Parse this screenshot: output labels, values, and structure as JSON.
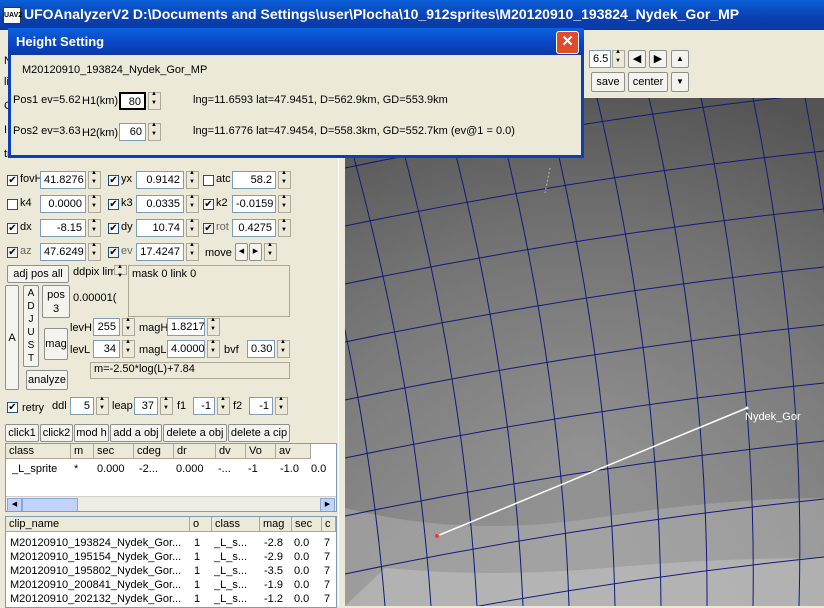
{
  "window": {
    "icon_text": "UAV2",
    "title": "UFOAnalyzerV2 D:\\Documents and Settings\\user\\Plocha\\10_912sprites\\M20120910_193824_Nydek_Gor_MP"
  },
  "top_controls": {
    "zoom_value": "6.5",
    "save_label": "save",
    "center_label": "center"
  },
  "dialog": {
    "title": "Height Setting",
    "clip_name": "M20120910_193824_Nydek_Gor_MP",
    "pos1_label": "Pos1 ev=5.62",
    "h1_label": "H1(km)",
    "h1_value": "80",
    "pos1_info": "lng=11.6593 lat=47.9451, D=562.9km, GD=553.9km",
    "pos2_label": "Pos2 ev=3.63",
    "h2_label": "H2(km)",
    "h2_value": "60",
    "pos2_info": "lng=11.6776 lat=47.9454, D=558.3km, GD=552.7km  (ev@1 = 0.0)"
  },
  "params": {
    "fovh_label": "fovH",
    "fovh_value": "41.8276",
    "yx_label": "yx",
    "yx_value": "0.9142",
    "atc_label": "atc",
    "atc_value": "58.2",
    "k4_label": "k4",
    "k4_value": "0.0000",
    "k3_label": "k3",
    "k3_value": "0.0335",
    "k2_label": "k2",
    "k2_value": "-0.0159",
    "dx_label": "dx",
    "dx_value": "-8.15",
    "dy_label": "dy",
    "dy_value": "10.74",
    "rot_label": "rot",
    "rot_value": "0.4275",
    "az_label": "az",
    "az_value": "47.6249",
    "ev_label": "ev",
    "ev_value": "17.4247",
    "move_label": "move"
  },
  "adjust": {
    "adj_pos_all": "adj pos all",
    "ddpix_label": "ddpix lim",
    "ddpix_value": "0.00001(",
    "mask_link": "mask 0  link 0",
    "a_label": "A",
    "adjust_letters": [
      "A",
      "D",
      "J",
      "U",
      "S",
      "T"
    ],
    "pos3_line1": "pos",
    "pos3_line2": "3",
    "mag_btn": "mag",
    "levh_label": "levH",
    "levh_value": "255",
    "magh_label": "magH",
    "magh_value": "1.8217",
    "levl_label": "levL",
    "levl_value": "34",
    "magl_label": "magL",
    "magl_value": "4.0000",
    "bvf_label": "bvf",
    "bvf_value": "0.30",
    "formula": "m=-2.50*log(L)+7.84",
    "analyze": "analyze"
  },
  "retry": {
    "retry_label": "retry",
    "ddl_label": "ddl",
    "ddl_value": "5",
    "leap_label": "leap",
    "leap_value": "37",
    "f1_label": "f1",
    "f1_value": "-1",
    "f2_label": "f2",
    "f2_value": "-1"
  },
  "actions": [
    "click1",
    "click2",
    "mod h",
    "add a obj",
    "delete a obj",
    "delete a cip"
  ],
  "obj_table": {
    "headers": [
      "class",
      "m",
      "sec",
      "cdeg",
      "dr",
      "dv",
      "Vo",
      "av"
    ],
    "rows": [
      [
        "_L_sprite",
        "*",
        "0.000",
        "-2...",
        "0.000",
        "-...",
        "-1",
        "-1.0",
        "0.0"
      ]
    ]
  },
  "clip_table": {
    "headers": [
      "clip_name",
      "o",
      "class",
      "mag",
      "sec",
      "c"
    ],
    "rows": [
      [
        "M20120910_193824_Nydek_Gor...",
        "1",
        "_L_s...",
        "-2.8",
        "0.0",
        "7"
      ],
      [
        "M20120910_195154_Nydek_Gor...",
        "1",
        "_L_s...",
        "-2.9",
        "0.0",
        "7"
      ],
      [
        "M20120910_195802_Nydek_Gor...",
        "1",
        "_L_s...",
        "-3.5",
        "0.0",
        "7"
      ],
      [
        "M20120910_200841_Nydek_Gor...",
        "1",
        "_L_s...",
        "-1.9",
        "0.0",
        "7"
      ],
      [
        "M20120910_202132_Nydek_Gor...",
        "1",
        "_L_s...",
        "-1.2",
        "0.0",
        "7"
      ]
    ]
  },
  "map": {
    "station_label": "Nydek_Gor"
  },
  "partial_labels": {
    "l1": "N",
    "l2": "li",
    "l3": "C",
    "l4": "I",
    "l5": "tr"
  }
}
